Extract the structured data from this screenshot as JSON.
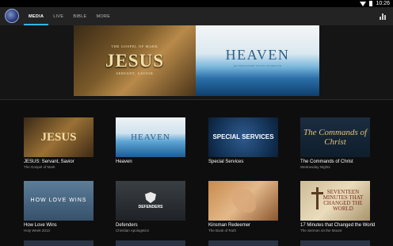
{
  "status_bar": {
    "time": "10:26"
  },
  "tabs": [
    {
      "label": "MEDIA"
    },
    {
      "label": "LIVE"
    },
    {
      "label": "BIBLE"
    },
    {
      "label": "MORE"
    }
  ],
  "hero": {
    "jesus": {
      "pre": "THE GOSPEL OF MARK",
      "title": "JESUS",
      "sub": "SERVANT, SAVIOR"
    },
    "heaven": {
      "title": "HEAVEN",
      "sub": "AN EXPOSITORY STUDY ON HEAVEN"
    }
  },
  "cards": [
    {
      "thumb": "JESUS",
      "title": "JESUS: Servant, Savior",
      "subtitle": "The Gospel of Mark"
    },
    {
      "thumb": "HEAVEN",
      "title": "Heaven",
      "subtitle": ""
    },
    {
      "thumb": "SPECIAL SERVICES",
      "title": "Special Services",
      "subtitle": ""
    },
    {
      "thumb": "The Commands of Christ",
      "title": "The Commands of Christ",
      "subtitle": "Wednesday Nights"
    },
    {
      "thumb": "HOW LOVE WINS",
      "title": "How Love Wins",
      "subtitle": "Holy Week 2013"
    },
    {
      "thumb": "DEFENDERS",
      "title": "Defenders",
      "subtitle": "Christian Apologetics"
    },
    {
      "thumb": "",
      "title": "Kinsman Redeemer",
      "subtitle": "The Book of Ruth"
    },
    {
      "thumb": "SEVENTEEN MINUTES THAT CHANGED THE WORLD",
      "title": "17 Minutes that Changed the World",
      "subtitle": "The Sermon on the Mount"
    }
  ]
}
